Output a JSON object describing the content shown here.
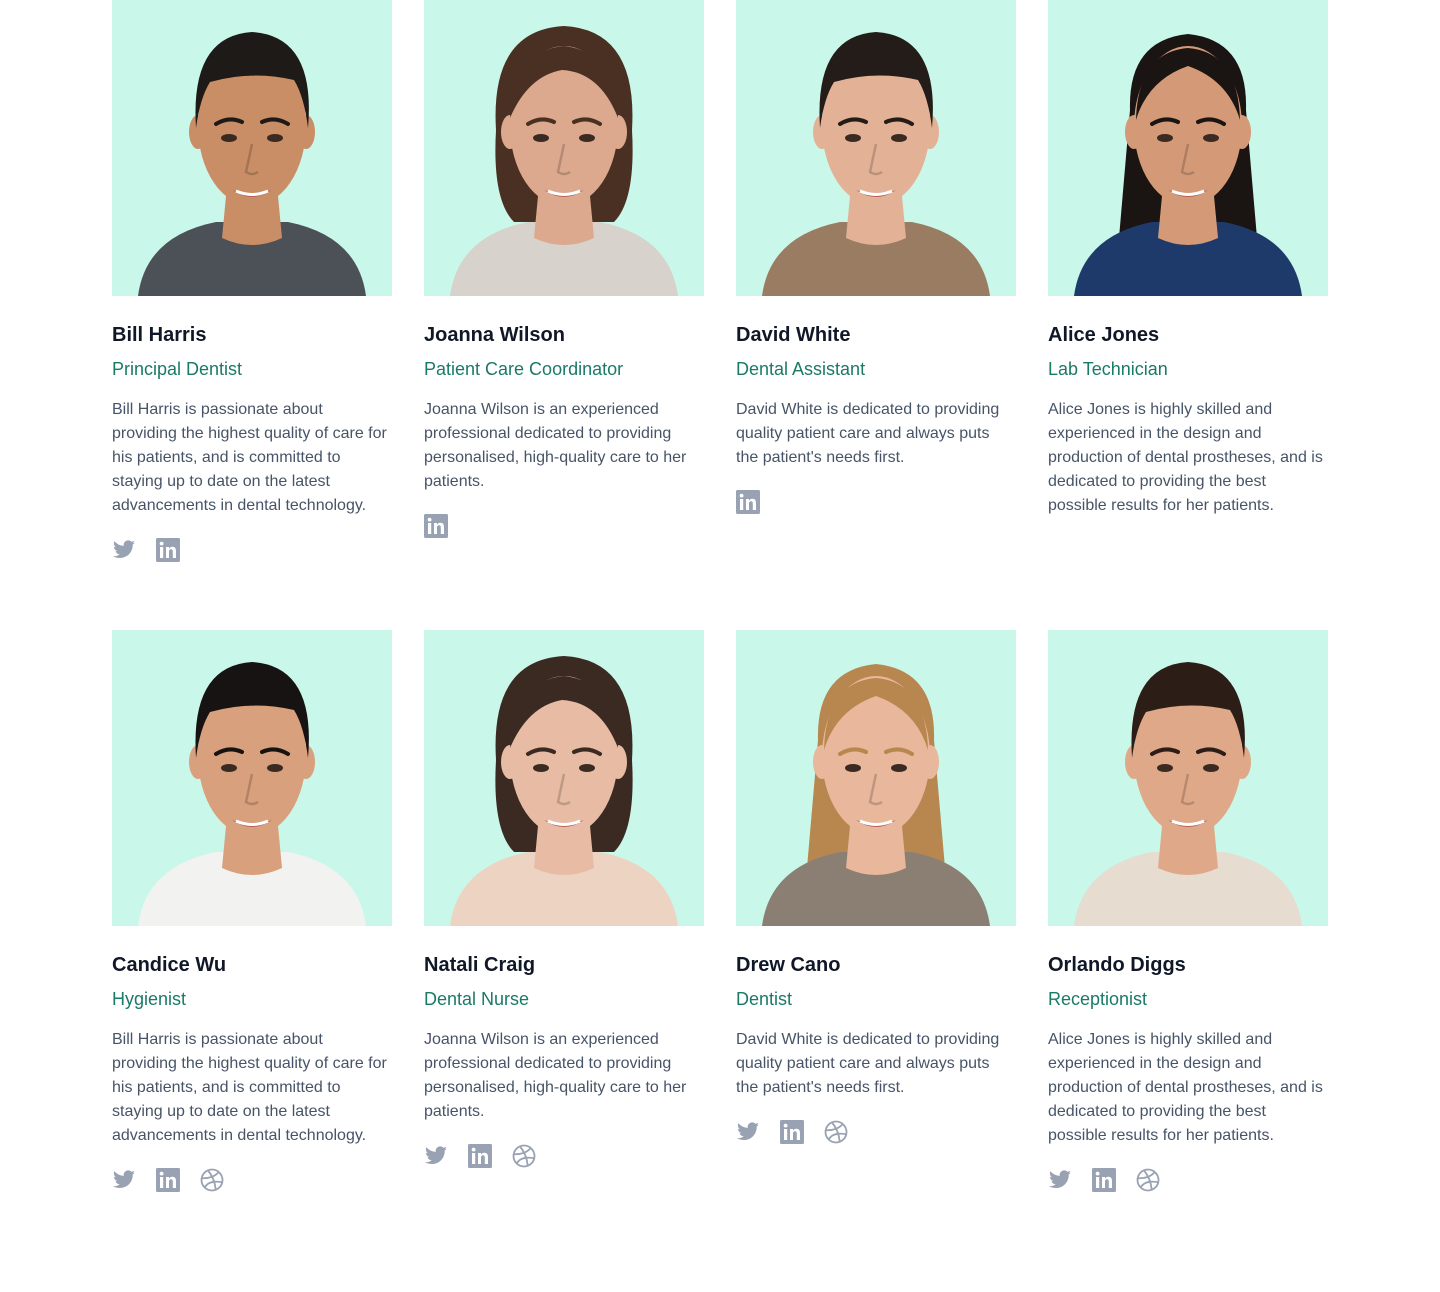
{
  "colors": {
    "photo_bg": "#c9f7ea",
    "name": "#101828",
    "role": "#1a7a67",
    "bio": "#475467",
    "icon": "#98a2b3"
  },
  "team": [
    {
      "name": "Bill Harris",
      "role": "Principal Dentist",
      "bio": "Bill Harris is passionate about providing the highest quality of care for his patients, and is committed to staying up to date on the latest advancements in dental technology.",
      "socials": [
        "twitter-icon",
        "linkedin-icon"
      ],
      "skin": "#c98e66",
      "hair": "#1d1a18",
      "shirt": "#4b5157",
      "hair_style": "short"
    },
    {
      "name": "Joanna Wilson",
      "role": "Patient Care Coordinator",
      "bio": "Joanna Wilson is an experienced professional dedicated to providing personalised, high-quality care to her patients.",
      "socials": [
        "linkedin-icon"
      ],
      "skin": "#dca98e",
      "hair": "#4a3022",
      "shirt": "#d8d2cc",
      "hair_style": "bob"
    },
    {
      "name": "David White",
      "role": "Dental Assistant",
      "bio": "David White is dedicated to providing quality patient care and always puts the patient's needs first.",
      "socials": [
        "linkedin-icon"
      ],
      "skin": "#e3b296",
      "hair": "#231c18",
      "shirt": "#9a7c62",
      "hair_style": "short"
    },
    {
      "name": "Alice Jones",
      "role": "Lab Technician",
      "bio": "Alice Jones is highly skilled and experienced in the design and production of dental prostheses, and is dedicated to providing the best possible results for her patients.",
      "socials": [],
      "skin": "#d49a78",
      "hair": "#1a1412",
      "shirt": "#1e3a6b",
      "hair_style": "long"
    },
    {
      "name": "Candice Wu",
      "role": "Hygienist",
      "bio": "Bill Harris is passionate about providing the highest quality of care for his patients, and is committed to staying up to date on the latest advancements in dental technology.",
      "socials": [
        "twitter-icon",
        "linkedin-icon",
        "dribbble-icon"
      ],
      "skin": "#d8a07c",
      "hair": "#171312",
      "shirt": "#f2f2f0",
      "hair_style": "short"
    },
    {
      "name": "Natali Craig",
      "role": "Dental Nurse",
      "bio": "Joanna Wilson is an experienced professional dedicated to providing personalised, high-quality care to her patients.",
      "socials": [
        "twitter-icon",
        "linkedin-icon",
        "dribbble-icon"
      ],
      "skin": "#e7bba4",
      "hair": "#3b2a22",
      "shirt": "#edd3c2",
      "hair_style": "bob"
    },
    {
      "name": "Drew Cano",
      "role": "Dentist",
      "bio": "David White is dedicated to providing quality patient care and always puts the patient's needs first.",
      "socials": [
        "twitter-icon",
        "linkedin-icon",
        "dribbble-icon"
      ],
      "skin": "#e8b79c",
      "hair": "#b8874f",
      "shirt": "#8a7f72",
      "hair_style": "long"
    },
    {
      "name": "Orlando Diggs",
      "role": "Receptionist",
      "bio": "Alice Jones is highly skilled and experienced in the design and production of dental prostheses, and is dedicated to providing the best possible results for her patients.",
      "socials": [
        "twitter-icon",
        "linkedin-icon",
        "dribbble-icon"
      ],
      "skin": "#dfa889",
      "hair": "#2c1e17",
      "shirt": "#e6dcd0",
      "hair_style": "short"
    }
  ]
}
